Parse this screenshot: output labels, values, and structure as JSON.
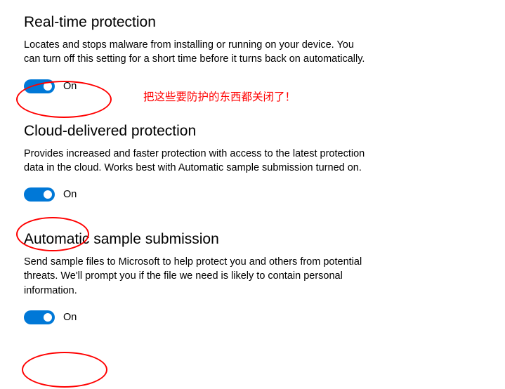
{
  "sections": {
    "realtime": {
      "title": "Real-time protection",
      "description": "Locates and stops malware from installing or running on your device. You can turn off this setting for a short time before it turns back on automatically.",
      "toggle_on": true,
      "toggle_label": "On"
    },
    "cloud": {
      "title": "Cloud-delivered protection",
      "description": "Provides increased and faster protection with access to the latest protection data in the cloud. Works best with Automatic sample submission turned on.",
      "toggle_on": true,
      "toggle_label": "On"
    },
    "sample": {
      "title": "Automatic sample submission",
      "description": "Send sample files to Microsoft to help protect you and others from potential threats. We'll prompt you if the file we need is likely to contain personal information.",
      "toggle_on": true,
      "toggle_label": "On"
    }
  },
  "annotation": {
    "text": "把这些要防护的东西都关闭了！"
  },
  "colors": {
    "accent": "#0078d7",
    "annotation": "#ff0000"
  }
}
